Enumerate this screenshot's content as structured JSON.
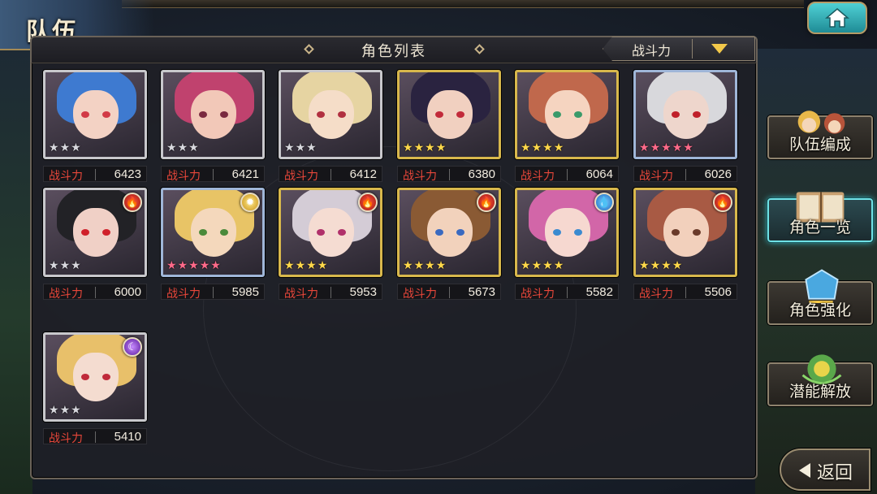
{
  "header": {
    "title": "队伍"
  },
  "panel": {
    "title": "角色列表"
  },
  "sort": {
    "label": "战斗力"
  },
  "power_label": "战斗力",
  "cards": [
    {
      "power": "6423",
      "stars": 3,
      "frame": "silver",
      "element": null,
      "hair": "#3e7ad0",
      "skin": "#f3d2c4",
      "eye": "#d23a46"
    },
    {
      "power": "6421",
      "stars": 3,
      "frame": "silver",
      "element": null,
      "hair": "#c0426e",
      "skin": "#f2c8b8",
      "eye": "#7a2a40"
    },
    {
      "power": "6412",
      "stars": 3,
      "frame": "silver",
      "element": null,
      "hair": "#e6d4a2",
      "skin": "#f5ddc8",
      "eye": "#b13040"
    },
    {
      "power": "6380",
      "stars": 4,
      "frame": "gold",
      "element": null,
      "hair": "#2a2340",
      "skin": "#f1d0c0",
      "eye": "#c22a3a"
    },
    {
      "power": "6064",
      "stars": 4,
      "frame": "gold",
      "element": null,
      "hair": "#c0684c",
      "skin": "#f5d4c0",
      "eye": "#3a9a6a"
    },
    {
      "power": "6026",
      "stars": 5,
      "frame": "rainbow",
      "element": null,
      "hair": "#d8d8dc",
      "skin": "#eed6cc",
      "eye": "#c0202a"
    },
    {
      "power": "6000",
      "stars": 3,
      "frame": "silver",
      "element": "fire",
      "hair": "#222226",
      "skin": "#f0d0c6",
      "eye": "#d0202a"
    },
    {
      "power": "5985",
      "stars": 5,
      "frame": "rainbow",
      "element": "light",
      "hair": "#e8c466",
      "skin": "#f4d8bc",
      "eye": "#4a8a3a"
    },
    {
      "power": "5953",
      "stars": 4,
      "frame": "gold",
      "element": "fire",
      "hair": "#d4ccd6",
      "skin": "#f5dcd2",
      "eye": "#b0306a"
    },
    {
      "power": "5673",
      "stars": 4,
      "frame": "gold",
      "element": "fire",
      "hair": "#8a5a34",
      "skin": "#f2d2bc",
      "eye": "#3a6ac0"
    },
    {
      "power": "5582",
      "stars": 4,
      "frame": "gold",
      "element": "water",
      "hair": "#d266a8",
      "skin": "#f6d8d0",
      "eye": "#3a8ad0"
    },
    {
      "power": "5506",
      "stars": 4,
      "frame": "gold",
      "element": "fire",
      "hair": "#a85a44",
      "skin": "#f2d0bc",
      "eye": "#6a3a2a"
    },
    {
      "power": "5410",
      "stars": 3,
      "frame": "silver",
      "element": "dark",
      "hair": "#e8c06a",
      "skin": "#f4dcd0",
      "eye": "#c02a3a"
    }
  ],
  "side_menu": [
    {
      "label": "队伍编成",
      "icon": "team-portraits-icon",
      "active": false
    },
    {
      "label": "角色一览",
      "icon": "book-icon",
      "active": true
    },
    {
      "label": "角色强化",
      "icon": "enhance-crystal-icon",
      "active": false
    },
    {
      "label": "潜能解放",
      "icon": "potential-orb-icon",
      "active": false
    }
  ],
  "back": {
    "label": "返回"
  },
  "colors": {
    "accent": "#6fe2e6",
    "power_label": "#e8473a",
    "sort_arrow": "#f2c84a"
  }
}
